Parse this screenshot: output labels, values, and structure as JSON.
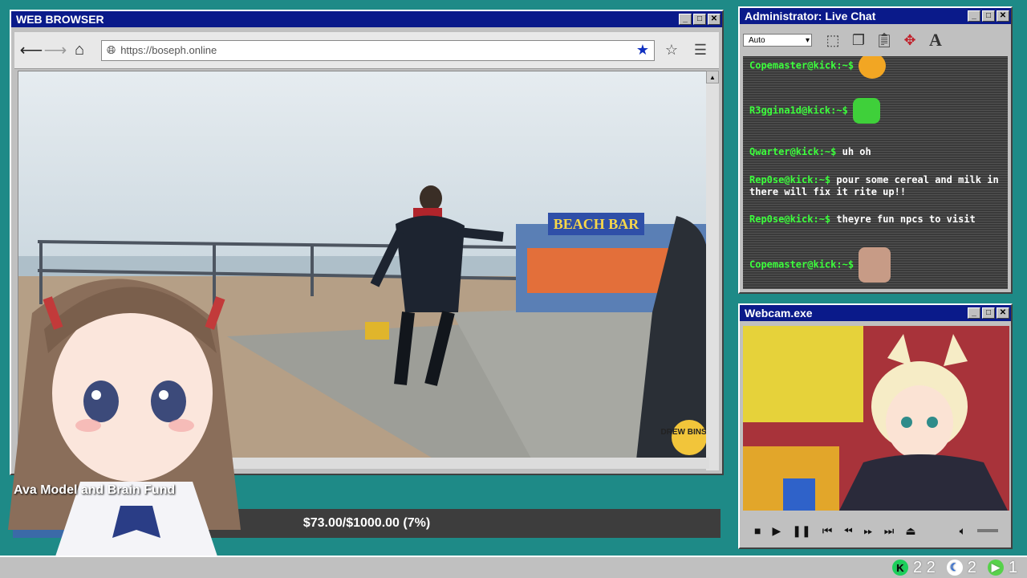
{
  "browser": {
    "title": "WEB BROWSER",
    "url": "https://boseph.online",
    "sign_text": "BEACH BAR",
    "watermark": "DREW BINSKY"
  },
  "chat": {
    "title": "Administrator: Live Chat",
    "font_select": "Auto",
    "messages": [
      {
        "user": "Copemaster@kick:~$",
        "text": ""
      },
      {
        "user": "R3ggina1d@kick:~$",
        "text": ""
      },
      {
        "user": "Qwarter@kick:~$",
        "text": "uh oh"
      },
      {
        "user": "Rep0se@kick:~$",
        "text": "pour some cereal and milk in there will fix it rite up!!"
      },
      {
        "user": "Rep0se@kick:~$",
        "text": "theyre fun npcs to visit"
      },
      {
        "user": "Copemaster@kick:~$",
        "text": ""
      }
    ]
  },
  "webcam": {
    "title": "Webcam.exe"
  },
  "fund": {
    "label": "Ava Model and Brain Fund",
    "text": "$73.00/$1000.00 (7%)",
    "fraction": 0.073
  },
  "taskbar": {
    "items": [
      {
        "icon": "kick-icon",
        "count": "2 2",
        "color": "#1bd05b"
      },
      {
        "icon": "moon-icon",
        "count": "2",
        "color": "#2b6bd6"
      },
      {
        "icon": "play-icon",
        "count": "1",
        "color": "#56d24a"
      }
    ]
  },
  "colors": {
    "desktop": "#1e8a87",
    "titlebar": "#0a1a8a",
    "username": "#3cff3c"
  }
}
